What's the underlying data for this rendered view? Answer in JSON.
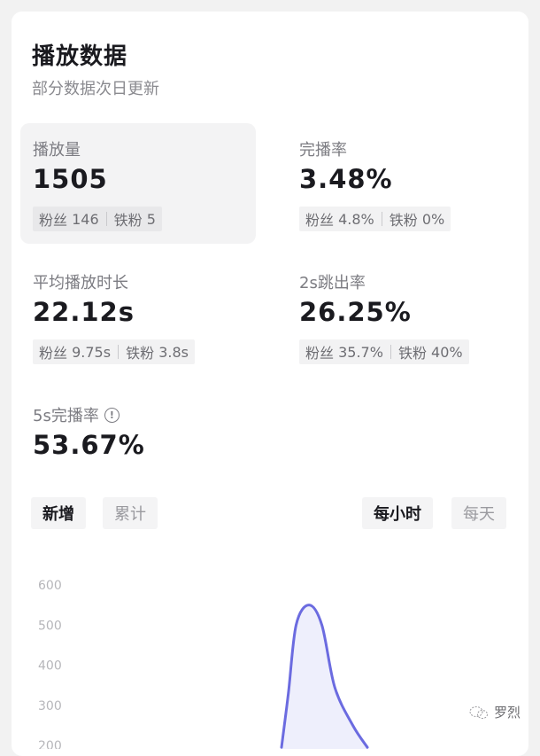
{
  "header": {
    "title": "播放数据",
    "subtitle": "部分数据次日更新"
  },
  "metrics": [
    {
      "label": "播放量",
      "value": "1505",
      "fans_label": "粉丝",
      "fans_value": "146",
      "iron_label": "铁粉",
      "iron_value": "5",
      "active": true
    },
    {
      "label": "完播率",
      "value": "3.48%",
      "fans_label": "粉丝",
      "fans_value": "4.8%",
      "iron_label": "铁粉",
      "iron_value": "0%",
      "active": false
    },
    {
      "label": "平均播放时长",
      "value": "22.12s",
      "fans_label": "粉丝",
      "fans_value": "9.75s",
      "iron_label": "铁粉",
      "iron_value": "3.8s",
      "active": false
    },
    {
      "label": "2s跳出率",
      "value": "26.25%",
      "fans_label": "粉丝",
      "fans_value": "35.7%",
      "iron_label": "铁粉",
      "iron_value": "40%",
      "active": false
    },
    {
      "label": "5s完播率",
      "value": "53.67%",
      "info_icon": "info-circle-icon"
    }
  ],
  "tabs": {
    "mode": [
      {
        "label": "新增",
        "selected": true
      },
      {
        "label": "累计",
        "selected": false
      }
    ],
    "granularity": [
      {
        "label": "每小时",
        "selected": true
      },
      {
        "label": "每天",
        "selected": false
      }
    ]
  },
  "chart_data": {
    "type": "area",
    "title": "",
    "xlabel": "",
    "ylabel": "",
    "y_ticks": [
      600,
      500,
      400,
      300,
      200
    ],
    "ylim": [
      195,
      620
    ],
    "series": [
      {
        "name": "播放量",
        "color": "#6b6be0",
        "fill": "#eeeffc",
        "points": [
          [
            0.0,
            195
          ],
          [
            0.08,
            330
          ],
          [
            0.17,
            500
          ],
          [
            0.32,
            550
          ],
          [
            0.47,
            500
          ],
          [
            0.62,
            345
          ],
          [
            0.83,
            250
          ],
          [
            1.0,
            195
          ]
        ]
      }
    ],
    "note": "Only the upper part of the chart is visible; x-axis is cropped. Points x are relative positions across the visible peak region."
  },
  "watermark": {
    "icon": "wechat-icon",
    "text": "罗烈"
  },
  "colors": {
    "accent": "#6b6be0",
    "card_bg": "#ffffff",
    "page_bg": "#f2f2f2"
  }
}
